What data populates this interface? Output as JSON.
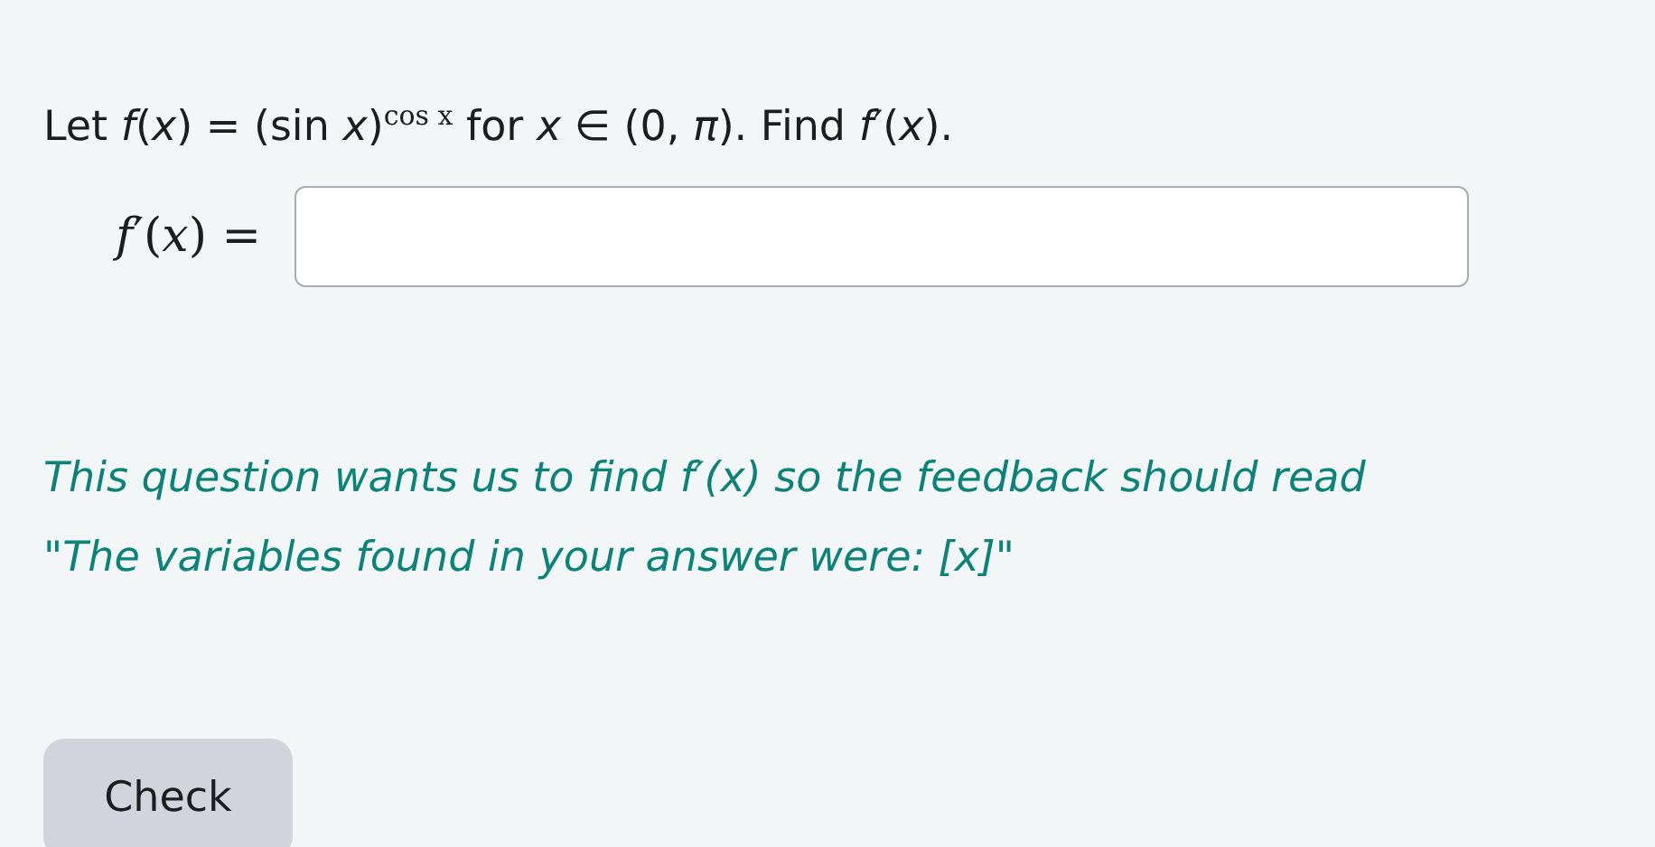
{
  "question": {
    "prompt": "Let *f*(*x*) = (sin *x*)$^{cos x}$ for *x* ∈ (0, *π*). Find *f*′(*x*).",
    "answer_label": "*f*′(*x*) ="
  },
  "feedback": "This question wants us to find *f*′(*x*) so the feedback should read \"The variables found in your answer were: [x]\"",
  "buttons": [
    {
      "label": "Check"
    }
  ]
}
